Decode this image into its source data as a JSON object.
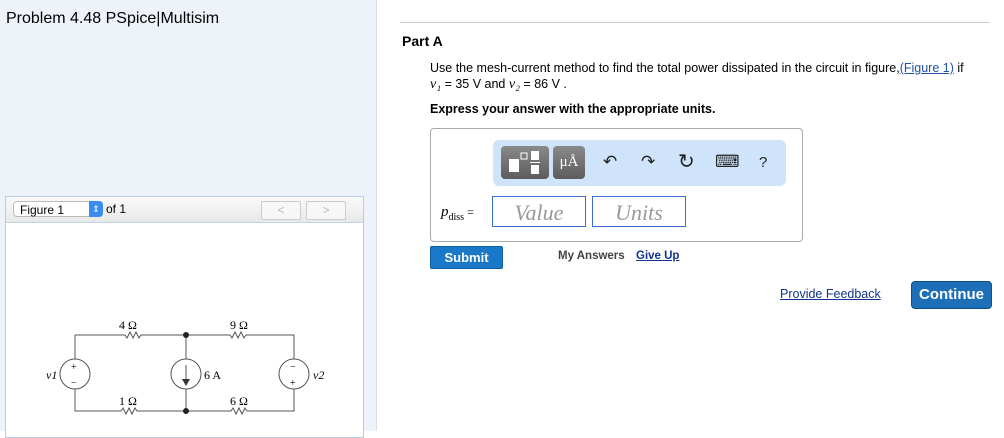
{
  "title": "Problem 4.48 PSpice|Multisim",
  "figure": {
    "select": "Figure 1",
    "of": "of 1",
    "prev": "<",
    "next": ">",
    "labels": {
      "r1": "4 Ω",
      "r2": "9 Ω",
      "r3": "1 Ω",
      "r4": "6 Ω",
      "is": "6 A",
      "v1": "v1",
      "v2": "v2",
      "plus": "+",
      "minus": "−"
    }
  },
  "part": "Part A",
  "question": {
    "text": "Use the mesh-current method to find the total power dissipated in the circuit in figure,",
    "link": "(Figure 1)",
    "if": " if",
    "v1": "v₁",
    "v1val": " = 35 V and ",
    "v2": "v₂",
    "v2val": " = 86 V ."
  },
  "express": "Express your answer with the appropriate units.",
  "toolbar": {
    "units": "μÅ",
    "undo": "↶",
    "redo": "↷",
    "reset": "↻",
    "keyboard": "⌨",
    "help": "?"
  },
  "answer": {
    "label": "p",
    "sub": "diss",
    "eq": " =",
    "value_placeholder": "Value",
    "units_placeholder": "Units"
  },
  "submit": "Submit",
  "my_answers": "My Answers",
  "give_up": "Give Up",
  "feedback": "Provide Feedback",
  "continue": "Continue"
}
